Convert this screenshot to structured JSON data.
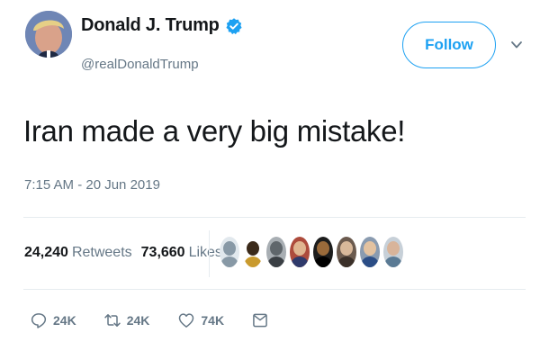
{
  "author": {
    "name": "Donald J. Trump",
    "handle": "@realDonaldTrump",
    "verified": true
  },
  "header": {
    "follow_label": "Follow",
    "caret_icon": "chevron-down-icon"
  },
  "tweet": {
    "text": "Iran made a very big mistake!",
    "timestamp": "7:15 AM - 20 Jun 2019"
  },
  "stats": {
    "retweets_count": "24,240",
    "retweets_label": "Retweets",
    "likes_count": "73,660",
    "likes_label": "Likes"
  },
  "actions": {
    "reply_count": "24K",
    "retweet_count": "24K",
    "like_count": "74K",
    "reply_icon": "reply-icon",
    "retweet_icon": "retweet-icon",
    "like_icon": "heart-icon",
    "dm_icon": "envelope-icon"
  },
  "colors": {
    "accent": "#1da1f2",
    "muted": "#657786",
    "text": "#14171a",
    "divider": "#e6ecf0"
  }
}
